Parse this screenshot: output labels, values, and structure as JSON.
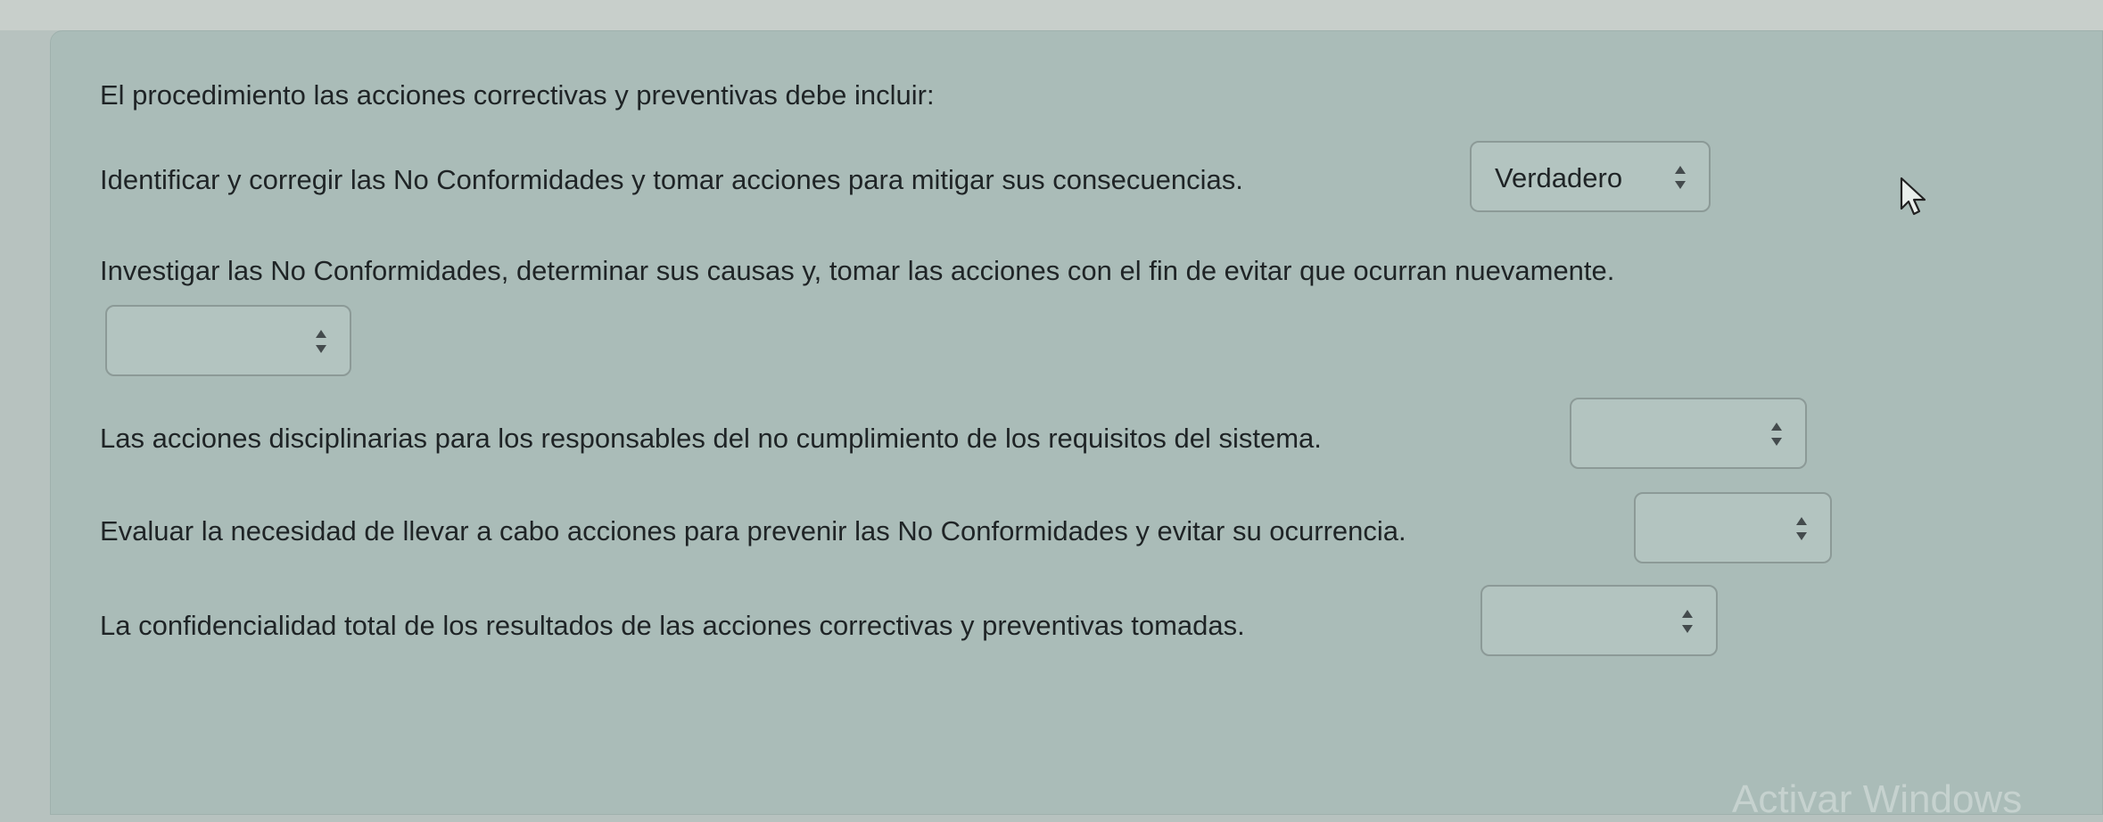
{
  "question": {
    "title": "El procedimiento las acciones correctivas y preventivas debe incluir:"
  },
  "items": [
    {
      "text": "Identificar y corregir las No Conformidades y tomar acciones para mitigar sus consecuencias.",
      "selected": "Verdadero"
    },
    {
      "text": "Investigar las No Conformidades, determinar sus causas y, tomar las acciones con el fin de evitar que ocurran nuevamente.",
      "selected": ""
    },
    {
      "text": "Las acciones disciplinarias para los responsables del no cumplimiento de los requisitos del sistema.",
      "selected": ""
    },
    {
      "text": "Evaluar la necesidad de llevar a cabo acciones para prevenir las No Conformidades y evitar su ocurrencia.",
      "selected": ""
    },
    {
      "text": "La confidencialidad total de los resultados de las acciones correctivas y preventivas tomadas.",
      "selected": ""
    }
  ],
  "watermark": "Activar Windows",
  "icons": {
    "select_caret": "up-down-caret-icon",
    "cursor": "mouse-pointer-icon"
  }
}
